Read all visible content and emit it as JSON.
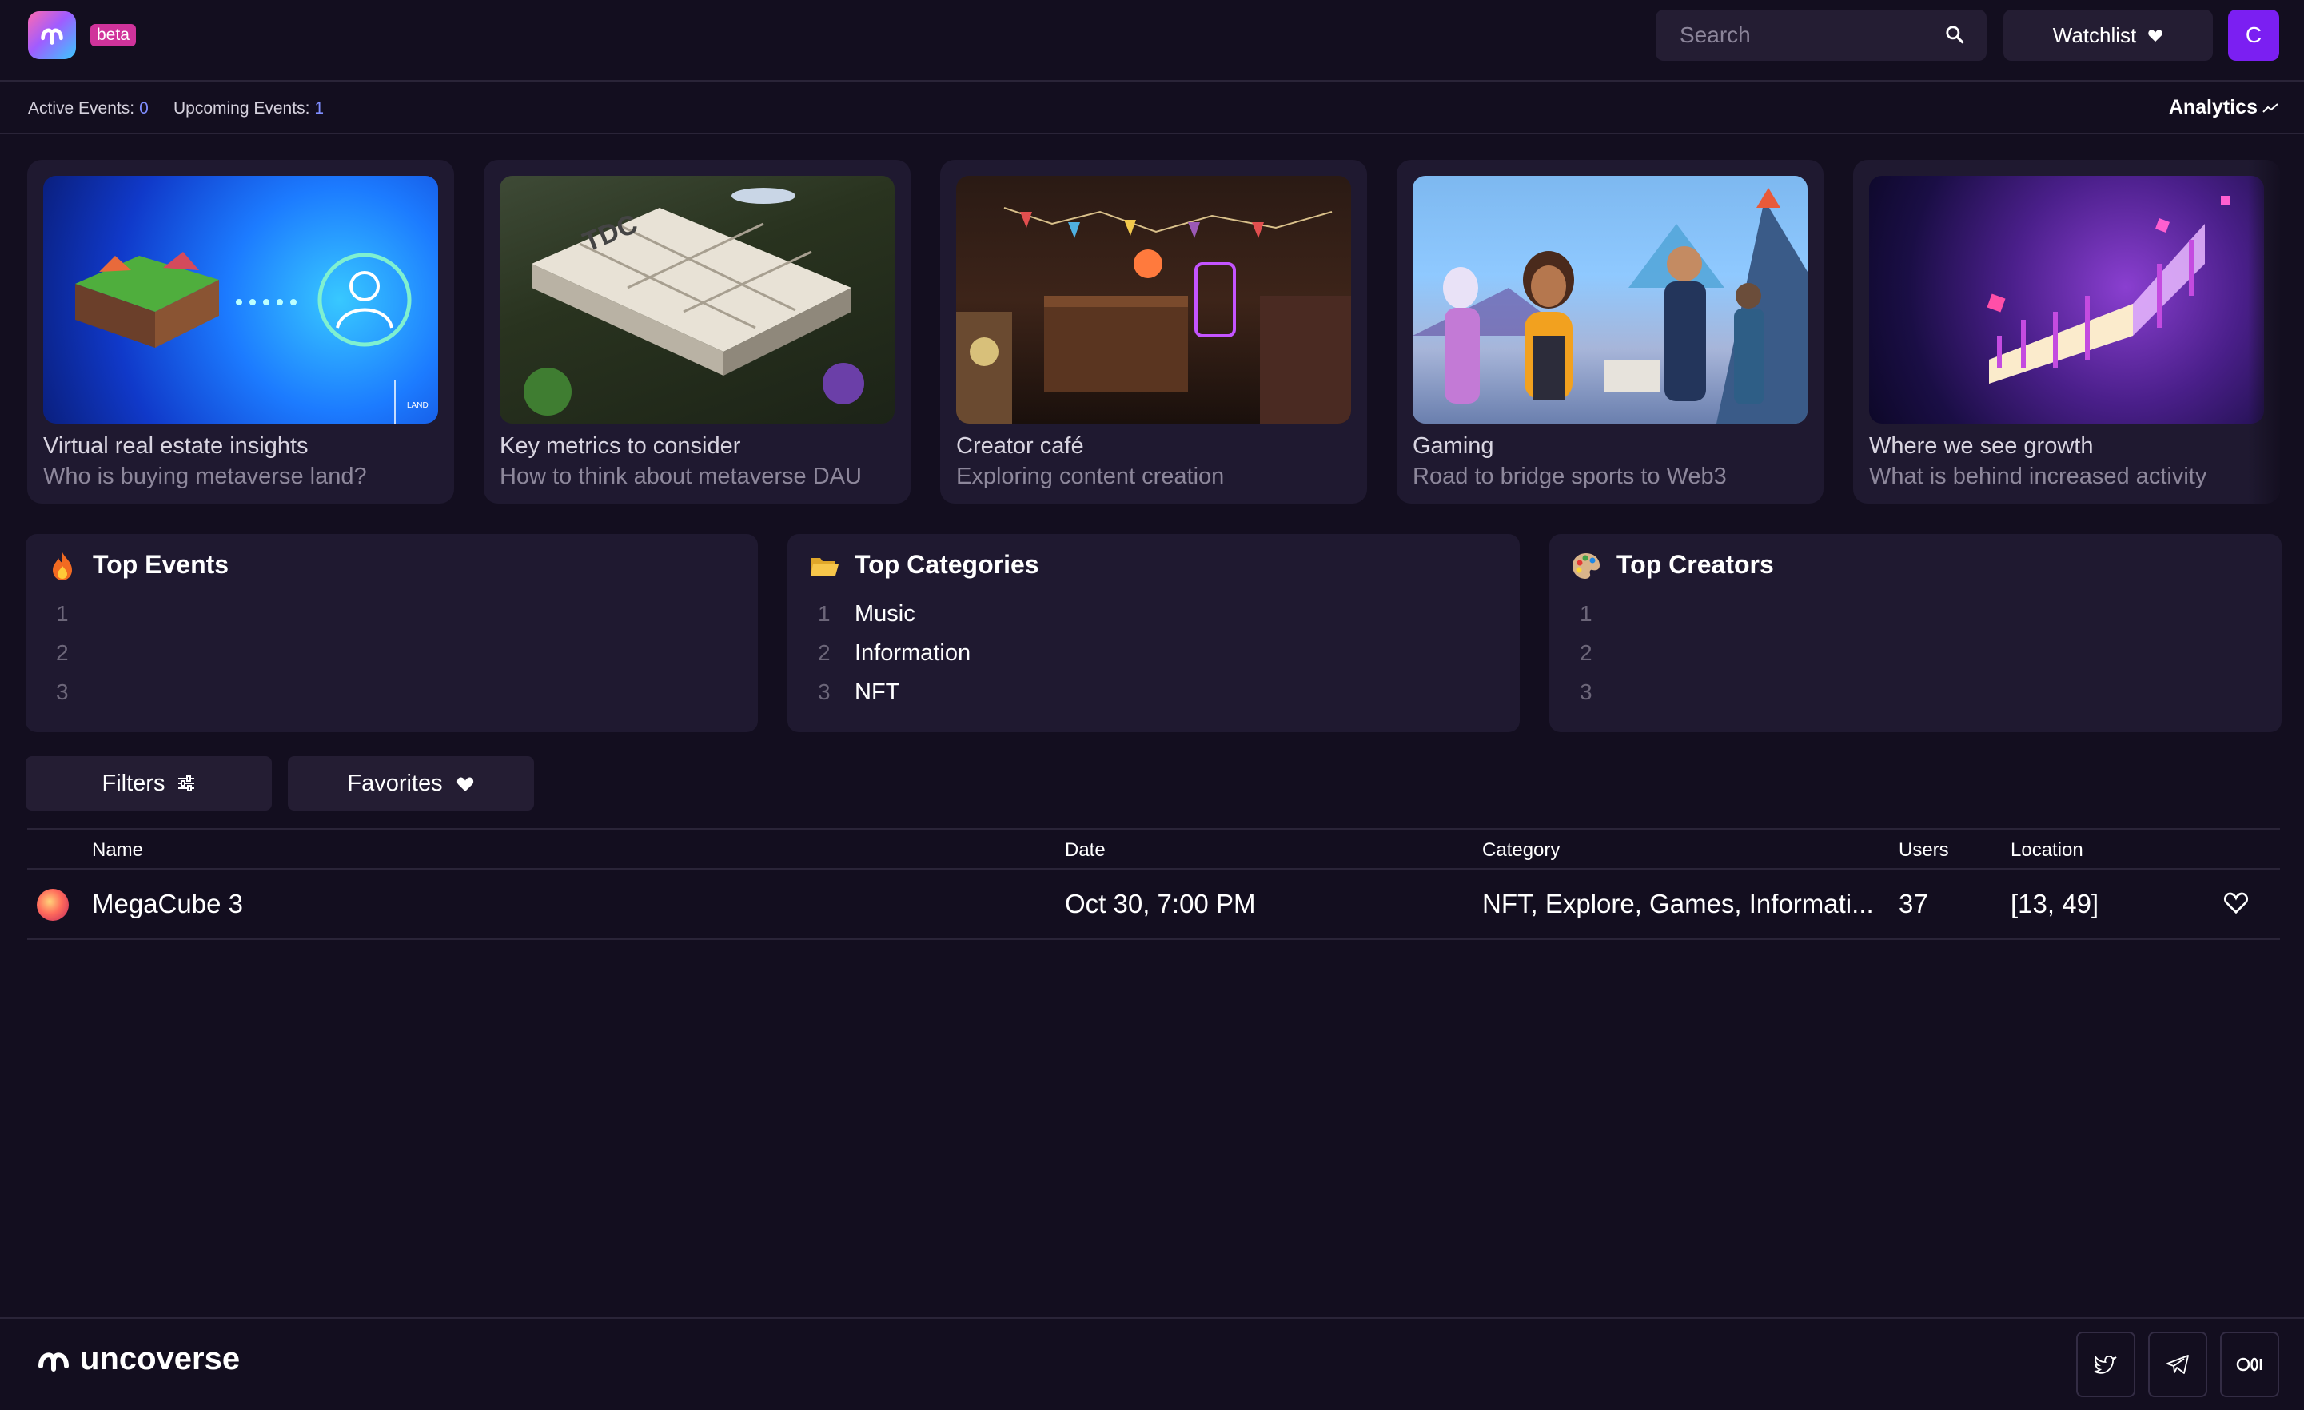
{
  "header": {
    "beta_label": "beta",
    "search_placeholder": "Search",
    "watchlist_label": "Watchlist",
    "user_initial": "C"
  },
  "stats": {
    "active_label": "Active Events:",
    "active_value": "0",
    "upcoming_label": "Upcoming Events:",
    "upcoming_value": "1",
    "analytics_label": "Analytics"
  },
  "articles": [
    {
      "title": "Virtual real estate insights",
      "subtitle": "Who is buying metaverse land?",
      "image": "land-island-illustration",
      "badge": "LAND"
    },
    {
      "title": "Key metrics to consider",
      "subtitle": "How to think about metaverse DAU",
      "image": "isometric-building-illustration",
      "badge": "TDC"
    },
    {
      "title": "Creator café",
      "subtitle": "Exploring content creation",
      "image": "cafe-interior-illustration"
    },
    {
      "title": "Gaming",
      "subtitle": "Road to bridge sports to Web3",
      "image": "game-characters-illustration"
    },
    {
      "title": "Where we see growth",
      "subtitle": "What is behind increased activity",
      "image": "growth-chart-illustration"
    }
  ],
  "panels": {
    "top_events": {
      "title": "Top Events",
      "icon": "fire-icon",
      "ranks": [
        "1",
        "2",
        "3"
      ],
      "items": [
        "",
        "",
        ""
      ]
    },
    "top_categories": {
      "title": "Top Categories",
      "icon": "folder-icon",
      "ranks": [
        "1",
        "2",
        "3"
      ],
      "items": [
        "Music",
        "Information",
        "NFT"
      ]
    },
    "top_creators": {
      "title": "Top Creators",
      "icon": "palette-icon",
      "ranks": [
        "1",
        "2",
        "3"
      ],
      "items": [
        "",
        "",
        ""
      ]
    }
  },
  "filters": {
    "filters_label": "Filters",
    "favorites_label": "Favorites"
  },
  "table": {
    "columns": [
      "Name",
      "Date",
      "Category",
      "Users",
      "Location"
    ],
    "rows": [
      {
        "name": "MegaCube 3",
        "date": "Oct 30, 7:00 PM",
        "category": "NFT, Explore, Games, Informati...",
        "users": "37",
        "location": "[13, 49]"
      }
    ]
  },
  "footer": {
    "brand": "uncoverse",
    "social": [
      "twitter-icon",
      "telegram-icon",
      "medium-icon"
    ]
  },
  "colors": {
    "background": "#130e1f",
    "surface": "#1f1930",
    "button": "#241d33",
    "accent_purple": "#7b1ff2",
    "beta_pink": "#d0339b",
    "stat_value": "#7f8dff"
  }
}
